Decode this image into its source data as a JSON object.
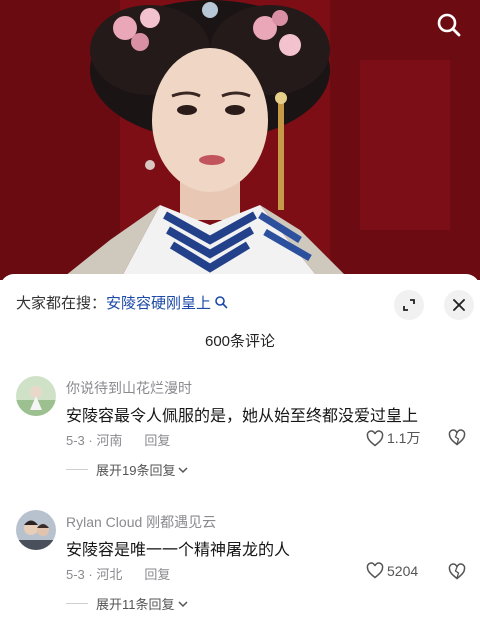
{
  "video": {
    "search_icon": "search-icon"
  },
  "sheet": {
    "search_prefix": "大家都在搜：",
    "search_query": "安陵容硬刚皇上",
    "search_suffix_icon": "search-icon",
    "expand_icon": "expand-icon",
    "close_icon": "close-icon",
    "comment_count": "600条评论"
  },
  "comments": [
    {
      "author": "你说待到山花烂漫时",
      "text": "安陵容最令人佩服的是，她从始至终都没爱过皇上",
      "date_location": "5-3 · 河南",
      "reply_label": "回复",
      "likes": "1.1万",
      "expand_replies": "展开19条回复"
    },
    {
      "author": "Rylan Cloud 刚都遇见云",
      "text": "安陵容是唯一一个精神屠龙的人",
      "date_location": "5-3 · 河北",
      "reply_label": "回复",
      "likes": "5204",
      "expand_replies": "展开11条回复"
    }
  ],
  "colors": {
    "accent_link": "#1d4aa8",
    "meta_gray": "#8a8a8f",
    "video_red": "#8e1119"
  }
}
